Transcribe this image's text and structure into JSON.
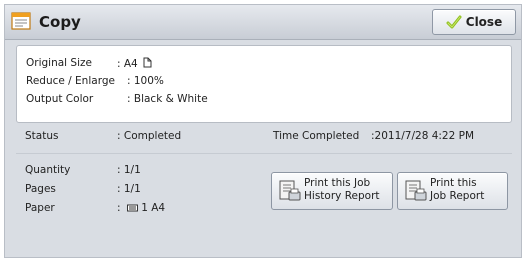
{
  "window": {
    "title": "Copy",
    "close_label": "Close"
  },
  "summary": {
    "original_size_label": "Original Size",
    "original_size_value": ": A4",
    "reduce_enlarge_label": "Reduce / Enlarge",
    "reduce_enlarge_value": ": 100%",
    "output_color_label": "Output Color",
    "output_color_value": ": Black & White"
  },
  "details": {
    "status_label": "Status",
    "status_value": ": Completed",
    "time_completed_label": "Time Completed",
    "time_completed_value": ":2011/7/28 4:22 PM",
    "quantity_label": "Quantity",
    "quantity_value": ": 1/1",
    "pages_label": "Pages",
    "pages_value": ": 1/1",
    "paper_label": "Paper",
    "paper_value_prefix": ":",
    "paper_value": "1 A4"
  },
  "buttons": {
    "history_report_label": "Print this Job\nHistory Report",
    "job_report_label": "Print this\nJob Report"
  },
  "icons": {
    "app": "copy-document-icon",
    "close": "check-icon",
    "orientation": "portrait-orientation-icon",
    "tray": "paper-tray-icon",
    "report": "print-report-icon"
  }
}
